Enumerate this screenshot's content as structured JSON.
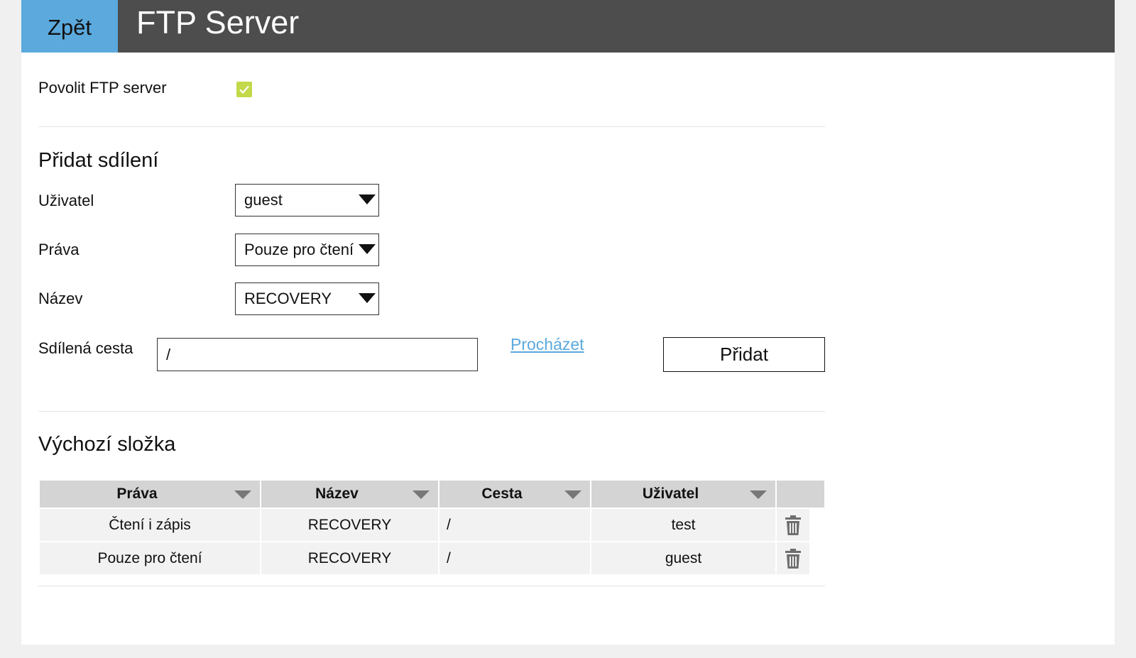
{
  "header": {
    "back_label": "Zpět",
    "title": "FTP Server",
    "colors": {
      "bar": "#4d4d4d",
      "back": "#5ba9dd"
    }
  },
  "enable_ftp": {
    "label": "Povolit FTP server",
    "checked": true,
    "check_color": "#c3d94a"
  },
  "add_share": {
    "title": "Přidat sdílení",
    "user": {
      "label": "Uživatel",
      "value": "guest"
    },
    "rights": {
      "label": "Práva",
      "value": "Pouze pro čtení"
    },
    "name": {
      "label": "Název",
      "value": "RECOVERY"
    },
    "path": {
      "label": "Sdílená cesta",
      "value": "/"
    },
    "browse_label": "Procházet",
    "add_label": "Přidat"
  },
  "default_folder": {
    "title": "Výchozí složka",
    "columns": [
      "Práva",
      "Název",
      "Cesta",
      "Uživatel"
    ],
    "rows": [
      {
        "rights": "Čtení i zápis",
        "name": "RECOVERY",
        "path": "/",
        "user": "test"
      },
      {
        "rights": "Pouze pro čtení",
        "name": "RECOVERY",
        "path": "/",
        "user": "guest"
      }
    ]
  },
  "icons": {
    "check": "check-icon",
    "dropdown": "chevron-down-icon",
    "delete": "trash-icon"
  }
}
